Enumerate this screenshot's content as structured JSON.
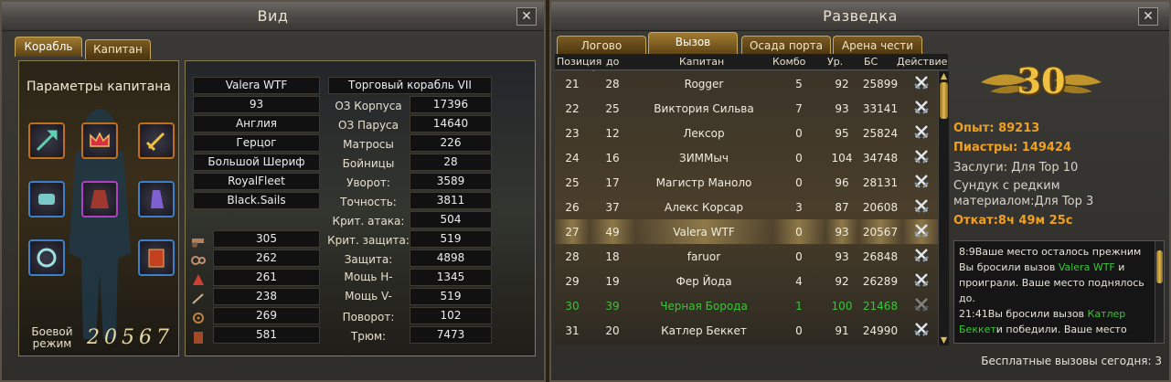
{
  "left_window": {
    "title": "Вид",
    "close_label": "✕",
    "tabs": [
      {
        "label": "Корабль"
      },
      {
        "label": "Капитан"
      }
    ],
    "params_title": "Параметры капитана",
    "combat_label": "Боевой режим",
    "combat_value": "20567",
    "captain_fields": [
      "Valera WTF",
      "93",
      "Англия",
      "Герцог",
      "Большой Шериф",
      "RoyalFleet",
      "Black.Sails"
    ],
    "ship_name": "Торговый корабль VII",
    "ship_stats": [
      {
        "label": "ОЗ Корпуса",
        "value": "17396"
      },
      {
        "label": "ОЗ Паруса",
        "value": "14640"
      },
      {
        "label": "Матросы",
        "value": "226"
      },
      {
        "label": "Бойницы",
        "value": "28"
      },
      {
        "label": "Уворот:",
        "value": "3589"
      },
      {
        "label": "Точность:",
        "value": "3811"
      },
      {
        "label": "Крит. атака:",
        "value": "504"
      },
      {
        "label": "Крит. защита:",
        "value": "519"
      },
      {
        "label": "Защита:",
        "value": "4898"
      },
      {
        "label": "Мощь Н-",
        "value": "1345"
      },
      {
        "label": "Мощь V-",
        "value": "519"
      },
      {
        "label": "Поворот:",
        "value": "102"
      },
      {
        "label": "Трюм:",
        "value": "7473"
      }
    ],
    "small_stats": [
      "305",
      "262",
      "261",
      "238",
      "269",
      "581"
    ]
  },
  "right_window": {
    "title": "Разведка",
    "close_label": "✕",
    "tabs": [
      {
        "label": "Логово пиратов"
      },
      {
        "label": "Вызов"
      },
      {
        "label": "Осада порта"
      },
      {
        "label": "Арена чести"
      }
    ],
    "columns": [
      "Позиция",
      "до",
      "Капитан",
      "Комбо",
      "Ур.",
      "БС",
      "Действие"
    ],
    "rows": [
      {
        "pos": "21",
        "to": "28",
        "captain": "Rogger",
        "combo": "5",
        "level": "92",
        "bs": "25899"
      },
      {
        "pos": "22",
        "to": "25",
        "captain": "Виктория Сильва",
        "combo": "7",
        "level": "93",
        "bs": "33141"
      },
      {
        "pos": "23",
        "to": "12",
        "captain": "Лексор",
        "combo": "0",
        "level": "95",
        "bs": "25824"
      },
      {
        "pos": "24",
        "to": "16",
        "captain": "ЗИММыч",
        "combo": "0",
        "level": "104",
        "bs": "34748"
      },
      {
        "pos": "25",
        "to": "17",
        "captain": "Магистр Маноло",
        "combo": "0",
        "level": "96",
        "bs": "28131"
      },
      {
        "pos": "26",
        "to": "37",
        "captain": "Алекс Корсар",
        "combo": "3",
        "level": "87",
        "bs": "20608"
      },
      {
        "pos": "27",
        "to": "49",
        "captain": "Valera WTF",
        "combo": "0",
        "level": "93",
        "bs": "20567"
      },
      {
        "pos": "28",
        "to": "18",
        "captain": "faruor",
        "combo": "0",
        "level": "93",
        "bs": "26848"
      },
      {
        "pos": "29",
        "to": "19",
        "captain": "Фер Йода",
        "combo": "4",
        "level": "92",
        "bs": "26289"
      },
      {
        "pos": "30",
        "to": "39",
        "captain": "Черная Борода",
        "combo": "1",
        "level": "100",
        "bs": "21468"
      },
      {
        "pos": "31",
        "to": "20",
        "captain": "Катлер Беккет",
        "combo": "0",
        "level": "91",
        "bs": "24990"
      }
    ],
    "rank_badge": "30",
    "exp_label": "Опыт:",
    "exp_value": "89213",
    "piastres_label": "Пиастры:",
    "piastres_value": "149424",
    "merits_text": "Заслуги: Для Top 10",
    "chest_text": "Сундук с редким материалом:Для Top 3",
    "cooldown_label": "Откат:",
    "cooldown_value": "8ч 49м 25с",
    "log": [
      {
        "time": "8:9",
        "text1": "Ваше место осталось прежним Вы бросили вызов ",
        "name": "Valera WTF",
        "text2": " и проиграли. Ваше место поднялось до."
      },
      {
        "time": "21:41",
        "text1": "Вы бросили вызов ",
        "name": "Катлер Беккет",
        "text2": "и победили. Ваше место"
      }
    ],
    "free_challenges": "Бесплатные вызовы сегодня: 3"
  },
  "colors": {
    "accent_gold": "#f0a020",
    "highlight_green": "#3bc43b",
    "tab_gold": "#c8a85a"
  }
}
